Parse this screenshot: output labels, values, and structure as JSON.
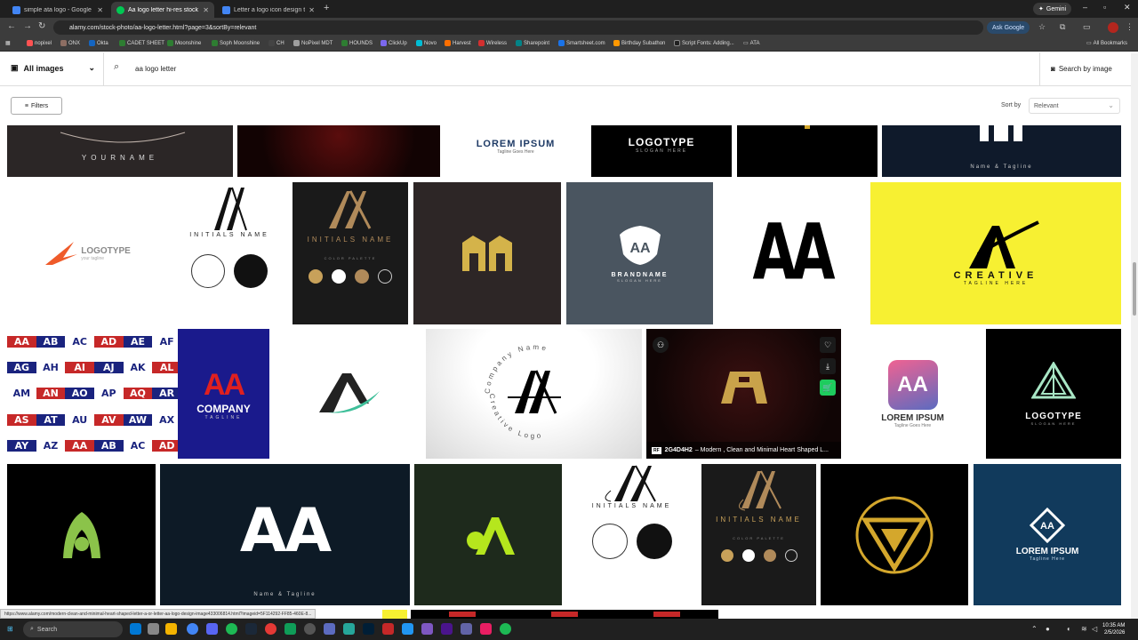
{
  "browser": {
    "tabs": [
      {
        "title": "simple ata logo - Google Search",
        "color": "#4285f4",
        "active": false
      },
      {
        "title": "Aa logo letter hi-res stock photos",
        "color": "#00c853",
        "active": true
      },
      {
        "title": "Letter a logo icon design template",
        "color": "#4285f4",
        "active": false
      }
    ],
    "gemini_label": "Gemini",
    "url": "alamy.com/stock-photo/aa-logo-letter.html?page=3&sortBy=relevant",
    "ask_google": "Ask Google",
    "bookmarks": [
      {
        "label": "nopixel",
        "color": "#ff5252"
      },
      {
        "label": "ONX",
        "color": "#8d6e63"
      },
      {
        "label": "Okta",
        "color": "#1565c0"
      },
      {
        "label": "CADET SHEET",
        "color": "#2e7d32"
      },
      {
        "label": "Moonshine",
        "color": "#2e7d32"
      },
      {
        "label": "Soph Moonshine",
        "color": "#2e7d32"
      },
      {
        "label": "CH",
        "color": "#444"
      },
      {
        "label": "NoPixel MDT",
        "color": "#9e9e9e"
      },
      {
        "label": "HOUNDS",
        "color": "#2e7d32"
      },
      {
        "label": "ClickUp",
        "color": "#7b68ee"
      },
      {
        "label": "Novo",
        "color": "#00bcd4"
      },
      {
        "label": "Harvest",
        "color": "#ff6f00"
      },
      {
        "label": "Wireless",
        "color": "#d32f2f"
      },
      {
        "label": "Sharepoint",
        "color": "#038387"
      },
      {
        "label": "Smartsheet.com",
        "color": "#1a73e8"
      },
      {
        "label": "Birthday Subathon",
        "color": "#ff9800"
      },
      {
        "label": "Script Fonts: Adding...",
        "color": "#212121"
      },
      {
        "label": "ATA",
        "color": "#777"
      }
    ],
    "all_bookmarks": "All Bookmarks"
  },
  "page": {
    "search_scope": "All images",
    "query": "aa logo letter",
    "search_by_image": "Search by image",
    "filters_label": "Filters",
    "sort_label": "Sort by",
    "sort_value": "Relevant"
  },
  "tiles": {
    "r1": {
      "yourname": "YOURNAME",
      "lorem": "LOREM IPSUM",
      "lorem_sub": "Tagline Goes Here",
      "logotype": "LOGOTYPE",
      "logotype_sub": "SLOGAN HERE",
      "name_tagline": "Name & Tagline"
    },
    "r2": {
      "logotype": "LOGOTYPE",
      "logotype_sub": "your tagline",
      "initials1": "INITIALS NAME",
      "initials2": "INITIALS NAME",
      "palette": "COLOR PALETTE",
      "brandname": "BRANDNAME",
      "brandsub": "SLOGAN HERE",
      "aa1": "AA",
      "aa2": "AA",
      "creative": "CREATIVE",
      "creative_sub": "TAGLINE HERE"
    },
    "r3": {
      "grid_letters": [
        "AA",
        "AB",
        "AC",
        "AD",
        "AE",
        "AF",
        "AG",
        "AH",
        "AI",
        "AJ",
        "AK",
        "AL",
        "AM",
        "AN",
        "AO",
        "AP",
        "AQ",
        "AR",
        "AS",
        "AT",
        "AU",
        "AV",
        "AW",
        "AX",
        "AY",
        "AZ",
        "AA",
        "AB",
        "AC",
        "AD"
      ],
      "company_aa": "AA",
      "company": "COMPANY",
      "company_sub": "TAGLINE",
      "company_name_arc": "Company Name",
      "creative_logo_arc": "Creative Logo",
      "caption_id": "2G4D4H2",
      "caption_text": "– Modern , Clean and Minimal Heart Shaped L...",
      "caption_badge": "RF",
      "lorem_aa": "AA",
      "lorem": "LOREM IPSUM",
      "lorem_sub": "Tagline Goes Here",
      "logotype": "LOGOTYPE",
      "logotype_sub": "SLOGAN HERE"
    },
    "r4": {
      "aa": "AA",
      "name_tagline": "Name & Tagline",
      "initials1": "INITIALS NAME",
      "initials2": "INITIALS NAME",
      "palette": "COLOR PALETTE",
      "aa_small": "AA",
      "lorem": "LOREM IPSUM",
      "lorem_sub": "Tagline Here"
    }
  },
  "status_url": "https://www.alamy.com/modern-clean-and-minimal-heart-shaped-letter-a-or-letter-aa-logo-design-image433006814.html?imageid=5F114292-FF85-460E-8...",
  "taskbar": {
    "search": "Search",
    "time": "10:35 AM",
    "date": "2/5/2026"
  },
  "colors": {
    "yellow_tile": "#f7f032",
    "navy": "#0d1a26",
    "gold": "#c8a15a",
    "lime": "#8bc34a"
  }
}
